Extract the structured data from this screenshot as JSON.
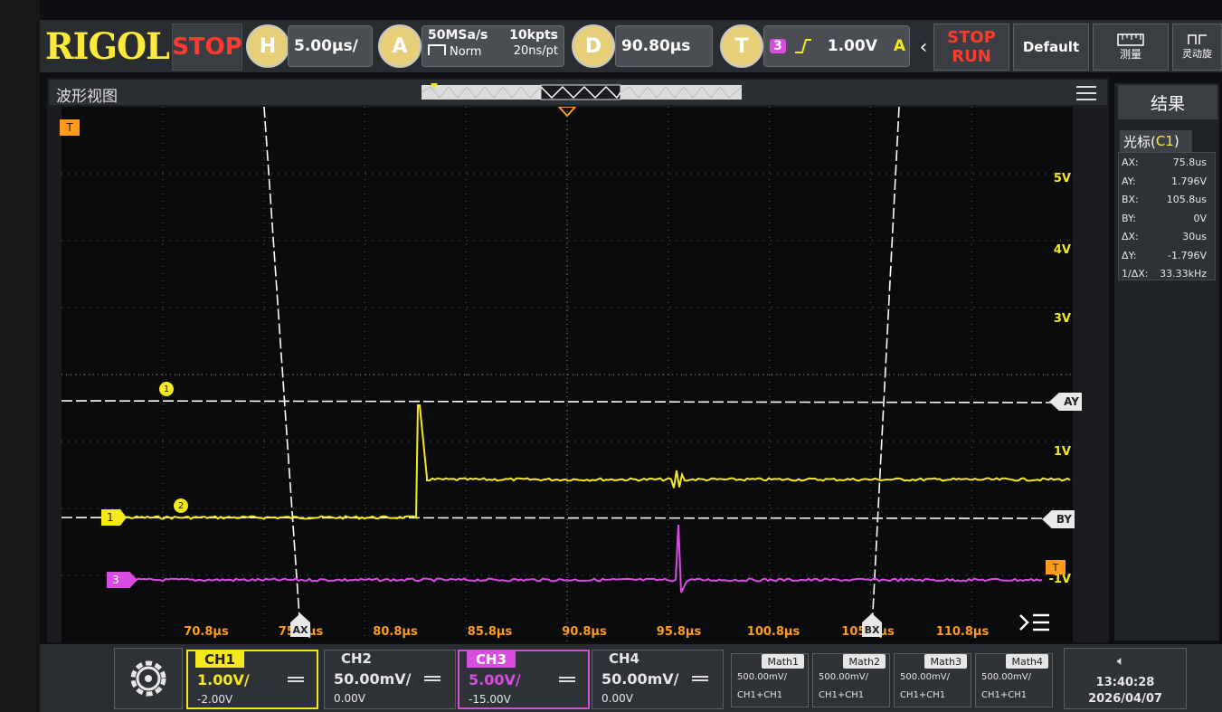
{
  "brand": {
    "logo": "RIGOL"
  },
  "toolbar": {
    "run_state": "STOP",
    "horizontal": {
      "badge": "H",
      "value": "5.00µs/"
    },
    "acquire": {
      "badge": "A",
      "rate": "50MSa/s",
      "depth": "10kpts",
      "mode": "Norm",
      "resolution": "20ns/pt"
    },
    "delay": {
      "badge": "D",
      "value": "90.80µs"
    },
    "trigger": {
      "badge": "T",
      "source": "3",
      "level": "1.00V",
      "mode": "A"
    },
    "stop_run": {
      "stop": "STOP",
      "run": "RUN"
    },
    "default_button": "Default",
    "measure_button": "测量",
    "flex_button": "灵动旋"
  },
  "waveform": {
    "title": "波形视图",
    "x_ticks": [
      "70.8µs",
      "75.8µs",
      "80.8µs",
      "85.8µs",
      "90.8µs",
      "95.8µs",
      "100.8µs",
      "105.8µs",
      "110.8µs"
    ],
    "y_ticks": [
      "5V",
      "4V",
      "3V",
      "1V",
      "-1V"
    ],
    "cursor_labels": {
      "ax": "AX",
      "bx": "BX",
      "ay": "AY",
      "by": "BY"
    },
    "ch1_marker": "1",
    "ch3_marker": "3",
    "trigger_marker": "T",
    "cursor_marker_1": "1",
    "cursor_marker_2": "2"
  },
  "results": {
    "title": "结果",
    "cursor_tab_prefix": "光标(",
    "cursor_tab_channel": "C1",
    "cursor_tab_suffix": ")",
    "rows": [
      {
        "key": "AX:",
        "value": "75.8us"
      },
      {
        "key": "AY:",
        "value": "1.796V"
      },
      {
        "key": "BX:",
        "value": "105.8us"
      },
      {
        "key": "BY:",
        "value": "0V"
      },
      {
        "key": "ΔX:",
        "value": "30us"
      },
      {
        "key": "ΔY:",
        "value": "-1.796V"
      },
      {
        "key": "1/ΔX:",
        "value": "33.33kHz"
      }
    ]
  },
  "channels": [
    {
      "name": "CH1",
      "scale": "1.00V/",
      "offset": "-2.00V",
      "color": "#f5e81c",
      "active": true
    },
    {
      "name": "CH2",
      "scale": "50.00mV/",
      "offset": "0.00V",
      "color": "#dddddd",
      "active": false
    },
    {
      "name": "CH3",
      "scale": "5.00V/",
      "offset": "-15.00V",
      "color": "#d84ce0",
      "active": true
    },
    {
      "name": "CH4",
      "scale": "50.00mV/",
      "offset": "0.00V",
      "color": "#dddddd",
      "active": false
    }
  ],
  "math": [
    {
      "name": "Math1",
      "scale": "500.00mV/",
      "source": "CH1+CH1"
    },
    {
      "name": "Math2",
      "scale": "500.00mV/",
      "source": "CH1+CH1"
    },
    {
      "name": "Math3",
      "scale": "500.00mV/",
      "source": "CH1+CH1"
    },
    {
      "name": "Math4",
      "scale": "500.00mV/",
      "source": "CH1+CH1"
    }
  ],
  "clock": {
    "time": "13:40:28",
    "date": "2026/04/07"
  },
  "colors": {
    "ch1": "#f5e81c",
    "ch3": "#d84ce0",
    "accent": "#e7cf7a",
    "stop": "#ff3b2f",
    "cursor": "#ffffff"
  }
}
